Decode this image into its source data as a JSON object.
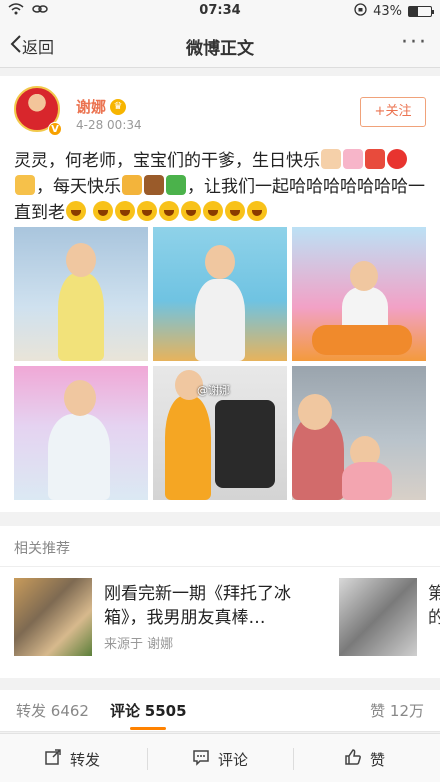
{
  "status": {
    "time": "07:34",
    "battery": "43%",
    "battery_level": 0.43
  },
  "nav": {
    "back_label": "返回",
    "title": "微博正文",
    "more_label": "···"
  },
  "post": {
    "username": "谢娜",
    "time": "4-28 00:34",
    "follow_label": "+关注",
    "text_part1": "灵灵，何老师，宝宝们的干爹，生日快乐",
    "text_part2": "每天快乐",
    "text_part3": "，让我们一起哈哈哈哈哈哈哈一直到老",
    "watermark": "@谢娜"
  },
  "related": {
    "title": "相关推荐",
    "items": [
      {
        "headline": "刚看完新一期《拜托了冰箱》，我男朋友真棒…",
        "source": "来源于 谢娜"
      },
      {
        "headline": "第的"
      }
    ]
  },
  "tabs": {
    "repost_label": "转发",
    "repost_count": "6462",
    "comment_label": "评论",
    "comment_count": "5505",
    "like_label": "赞",
    "like_count": "12万"
  },
  "toolbar": {
    "repost": "转发",
    "comment": "评论",
    "like": "赞"
  }
}
